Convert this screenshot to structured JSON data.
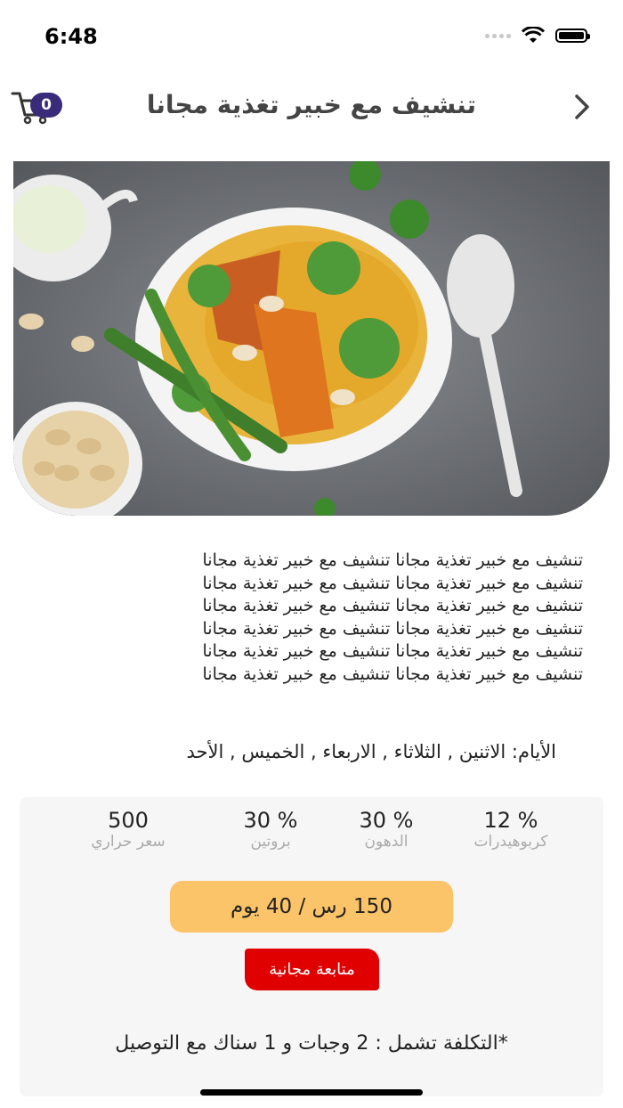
{
  "status_bar": {
    "time": "6:48"
  },
  "header": {
    "title": "تنشيف مع خبير تغذية مجانا",
    "cart_count": "0"
  },
  "description": [
    "تنشيف مع خبير تغذية مجانا تنشيف مع خبير تغذية مجانا",
    "تنشيف مع خبير تغذية مجانا تنشيف مع خبير تغذية مجانا",
    "تنشيف مع خبير تغذية مجانا تنشيف مع خبير تغذية مجانا",
    "تنشيف مع خبير تغذية مجانا تنشيف مع خبير تغذية مجانا",
    "تنشيف مع خبير تغذية مجانا تنشيف مع خبير تغذية مجانا",
    "تنشيف مع خبير تغذية مجانا تنشيف مع خبير تغذية مجانا"
  ],
  "days_text": "الأيام:  الاثنين ,  الثلاثاء ,  الاربعاء ,  الخميس ,  الأحد",
  "stats": [
    {
      "value": "12 %",
      "label": "كربوهيدرات"
    },
    {
      "value": "30 %",
      "label": "الدهون"
    },
    {
      "value": "30 %",
      "label": "بروتين"
    },
    {
      "value": "500",
      "label": "سعر حراري"
    }
  ],
  "price": "150 رس / 40 يوم",
  "follow_button": "متابعة مجانية",
  "cost_note": "*التكلفة تشمل : 2 وجبات  و 1 سناك  مع التوصيل",
  "colors": {
    "badge": "#3a2a7a",
    "price_pill": "#fcc468",
    "follow_button": "#e00000",
    "card_bg": "#f6f6f6"
  }
}
